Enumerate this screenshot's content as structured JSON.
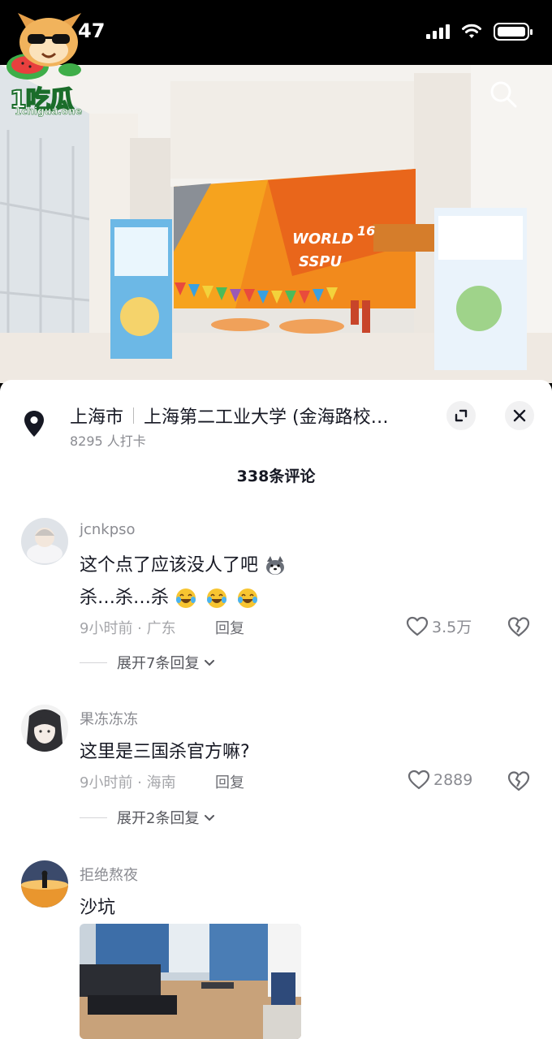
{
  "status_bar": {
    "time": "47"
  },
  "watermark": {
    "brand": "1吃瓜",
    "domain": "1chigua.one"
  },
  "location": {
    "city": "上海市",
    "place": "上海第二工业大学 (金海路校…",
    "checkins": "8295 人打卡"
  },
  "comments_header": {
    "total": "338条评论"
  },
  "comments": [
    {
      "username": "jcnkpso",
      "lines": [
        "这个点了应该没人了吧",
        "杀…杀…杀"
      ],
      "meta": "9小时前 · 广东",
      "reply_label": "回复",
      "likes": "3.5万",
      "expand": "展开7条回复"
    },
    {
      "username": "果冻冻冻",
      "lines": [
        "这里是三国杀官方嘛?"
      ],
      "meta": "9小时前 · 海南",
      "reply_label": "回复",
      "likes": "2889",
      "expand": "展开2条回复"
    },
    {
      "username": "拒绝熬夜",
      "lines": [
        "沙坑"
      ]
    }
  ],
  "icons": {
    "search": "search-icon",
    "location": "location-pin-icon",
    "minimize": "minimize-icon",
    "close": "close-icon",
    "like": "heart-icon",
    "dislike": "broken-heart-icon",
    "chevron": "chevron-down-icon"
  },
  "colors": {
    "sheet_bg": "#ffffff",
    "text_primary": "#161823",
    "text_secondary": "#8a8b91"
  }
}
